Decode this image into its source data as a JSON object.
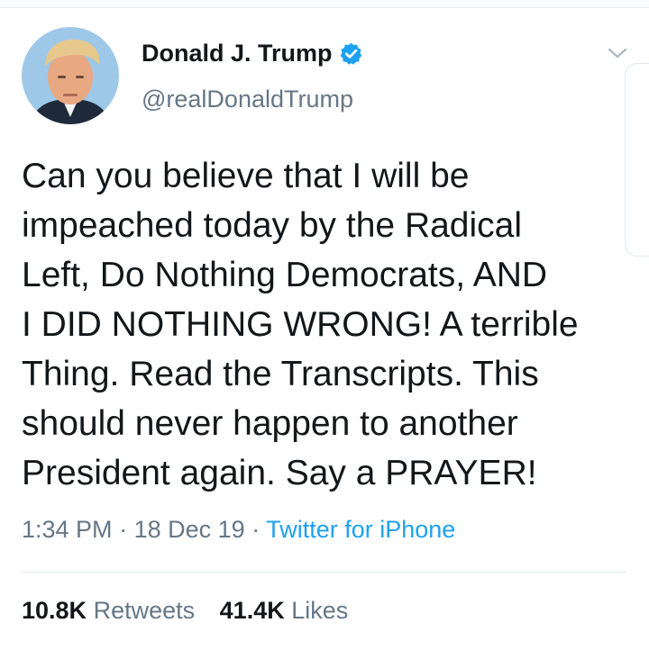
{
  "tweet": {
    "author_name": "Donald J. Trump",
    "handle": "@realDonaldTrump",
    "verified": true,
    "text_lines": [
      "Can you believe that I will be",
      "impeached today by the Radical",
      "Left, Do Nothing Democrats, AND",
      "I DID NOTHING WRONG! A terrible",
      "Thing. Read the Transcripts. This",
      "should never happen to another",
      "President again. Say a PRAYER!"
    ],
    "time": "1:34 PM",
    "date": "18 Dec 19",
    "separator": "·",
    "source": "Twitter for iPhone",
    "stats": {
      "retweets_count": "10.8K",
      "retweets_label": "Retweets",
      "likes_count": "41.4K",
      "likes_label": "Likes"
    }
  },
  "icons": {
    "avatar": "profile-photo",
    "verified": "verified-badge-icon",
    "menu": "chevron-down-icon"
  },
  "colors": {
    "text": "#14171a",
    "secondary": "#657786",
    "link": "#1da1f2",
    "divider": "#e1e8ed"
  }
}
